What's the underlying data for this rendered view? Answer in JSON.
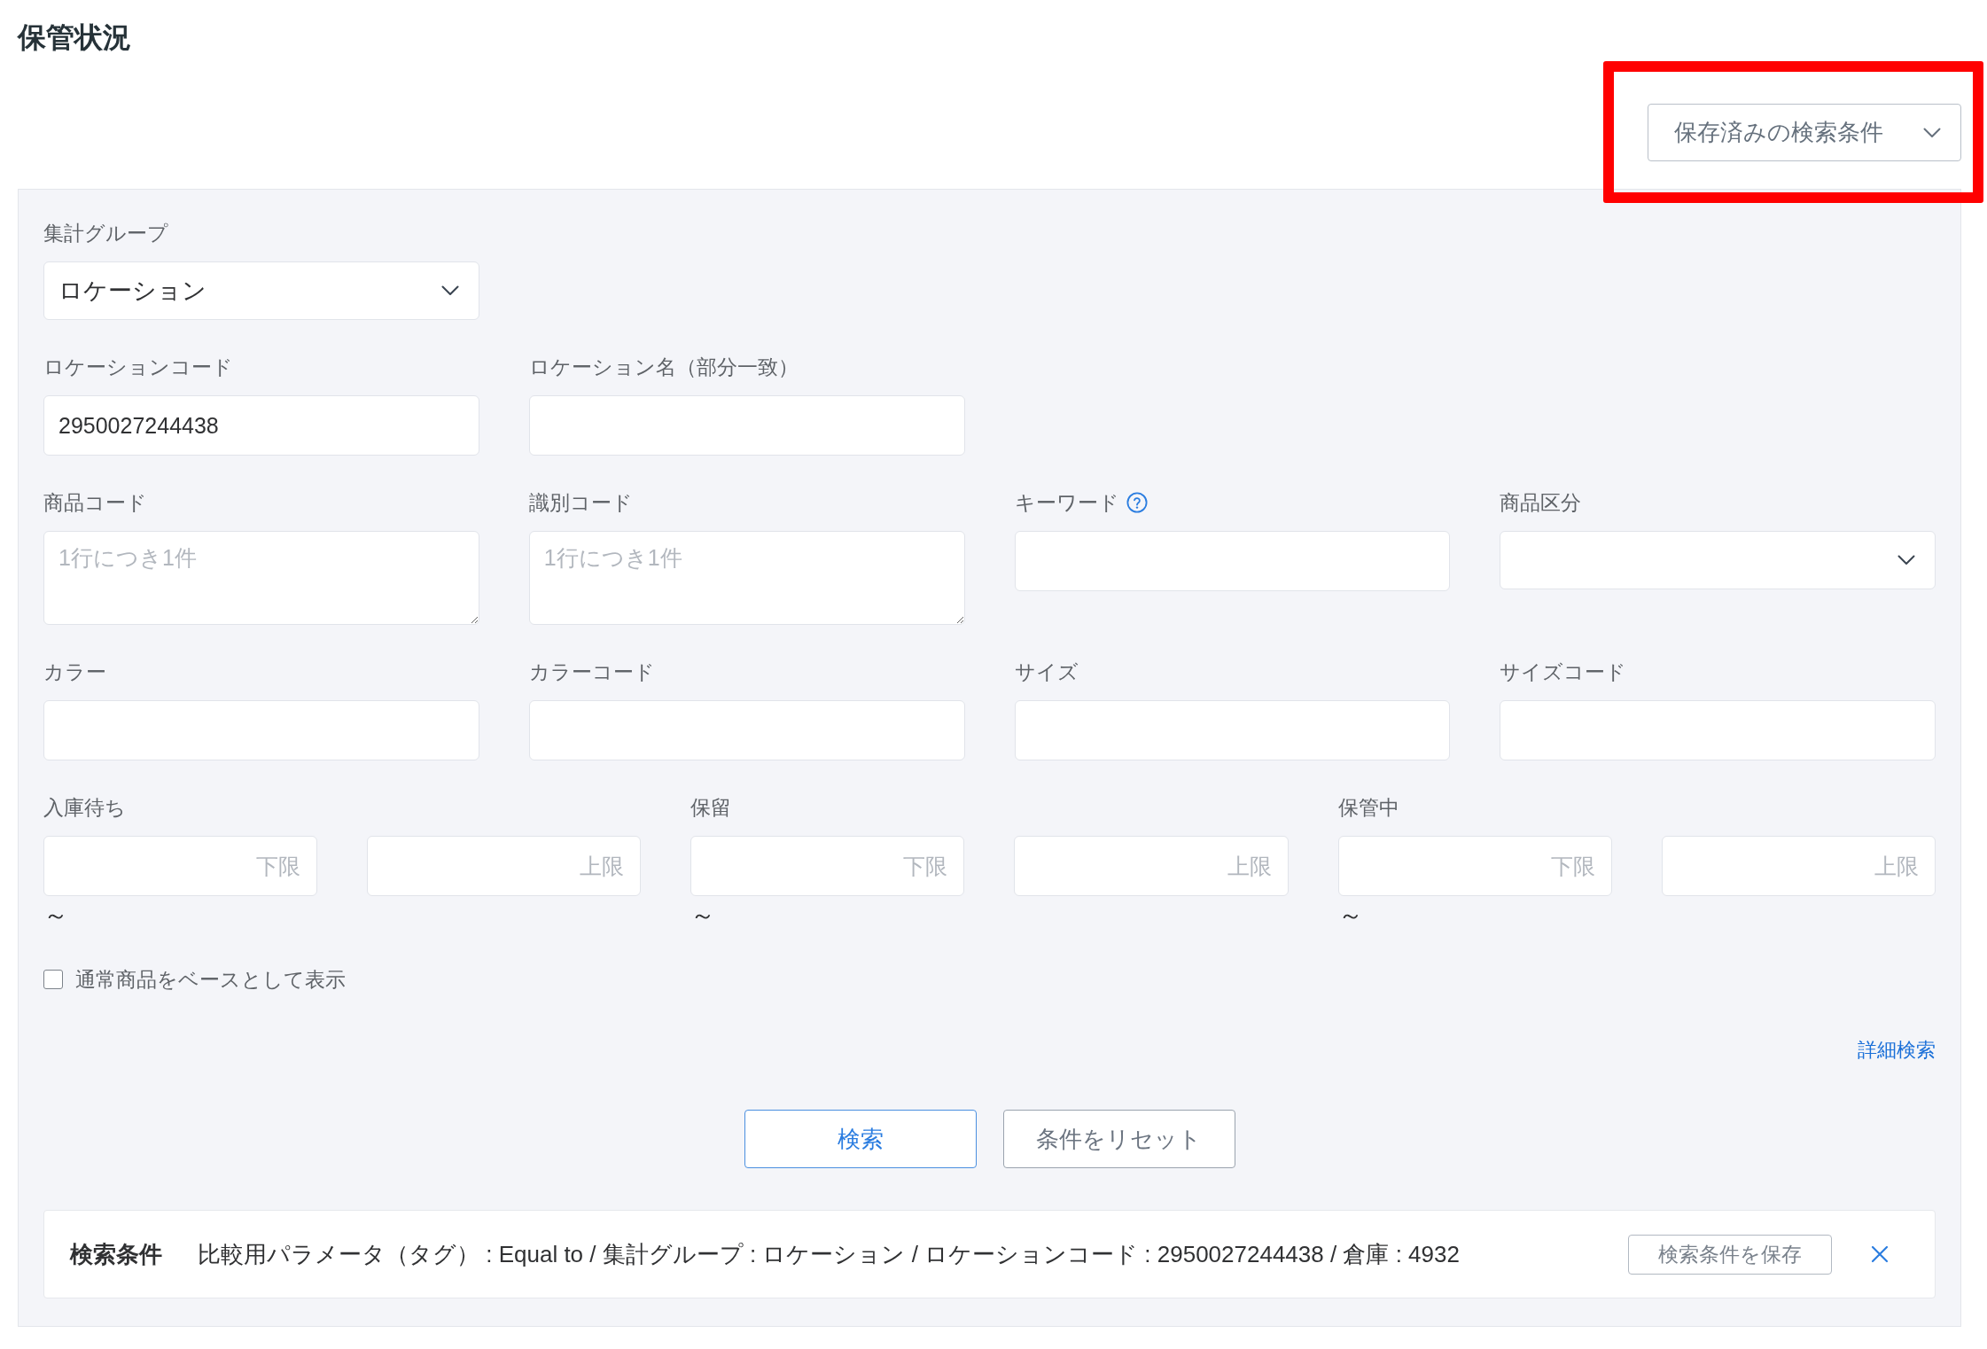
{
  "page": {
    "title": "保管状況"
  },
  "saved_search": {
    "label": "保存済みの検索条件",
    "highlighted": true
  },
  "form": {
    "rows": [
      {
        "fields": [
          {
            "kind": "select",
            "label": "集計グループ",
            "value": "ロケーション",
            "help": false
          }
        ]
      },
      {
        "fields": [
          {
            "kind": "text",
            "label": "ロケーションコード",
            "value": "2950027244438",
            "help": false
          },
          {
            "kind": "text",
            "label": "ロケーション名（部分一致）",
            "help": false
          }
        ]
      },
      {
        "fields": [
          {
            "kind": "textarea",
            "label": "商品コード",
            "placeholder": "1行につき1件",
            "help": false
          },
          {
            "kind": "textarea",
            "label": "識別コード",
            "placeholder": "1行につき1件",
            "help": false
          },
          {
            "kind": "text",
            "label": "キーワード",
            "help": true
          },
          {
            "kind": "select",
            "label": "商品区分",
            "help": false
          }
        ]
      },
      {
        "fields": [
          {
            "kind": "text",
            "label": "カラー",
            "help": false
          },
          {
            "kind": "text",
            "label": "カラーコード",
            "help": false
          },
          {
            "kind": "text",
            "label": "サイズ",
            "help": false
          },
          {
            "kind": "text",
            "label": "サイズコード",
            "help": false
          }
        ]
      }
    ],
    "ranges": [
      {
        "label": "入庫待ち",
        "min_placeholder": "下限",
        "max_placeholder": "上限",
        "separator": "～"
      },
      {
        "label": "保留",
        "min_placeholder": "下限",
        "max_placeholder": "上限",
        "separator": "～"
      },
      {
        "label": "保管中",
        "min_placeholder": "下限",
        "max_placeholder": "上限",
        "separator": "～"
      }
    ],
    "checkbox": {
      "label": "通常商品をベースとして表示",
      "checked": false
    },
    "advanced_link": "詳細検索",
    "buttons": [
      {
        "kind": "search",
        "label": "検索"
      },
      {
        "kind": "reset",
        "label": "条件をリセット"
      }
    ]
  },
  "summary": {
    "heading": "検索条件",
    "text": "比較用パラメータ（タグ） : Equal to / 集計グループ : ロケーション / ロケーションコード : 2950027244438 / 倉庫 : 4932",
    "save_button": "検索条件を保存"
  }
}
